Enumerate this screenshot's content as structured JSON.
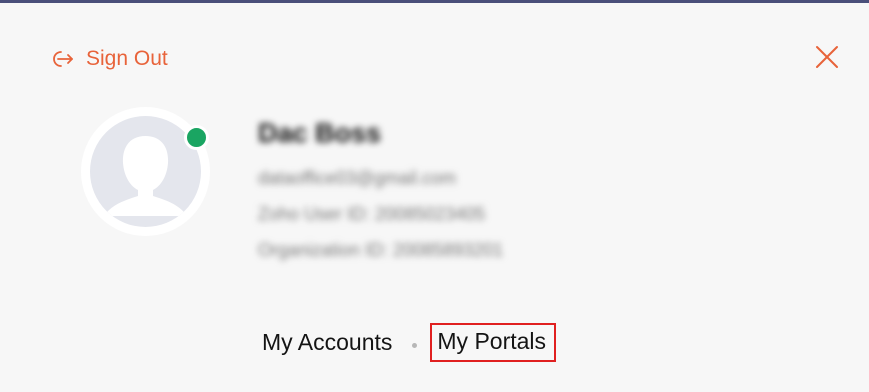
{
  "header": {
    "signout_label": "Sign Out",
    "accent_color": "#e8633a"
  },
  "user": {
    "name": "Dac Boss",
    "email": "dataoffice03@gmail.com",
    "zoho_user_id": "Zoho User ID: 20085023405",
    "organization_id": "Organization ID: 20085893201",
    "status": "online",
    "status_color": "#1aa562"
  },
  "links": {
    "accounts_label": "My Accounts",
    "portals_label": "My Portals"
  },
  "icons": [
    "sign-out-icon",
    "close-icon",
    "avatar-silhouette-icon"
  ]
}
